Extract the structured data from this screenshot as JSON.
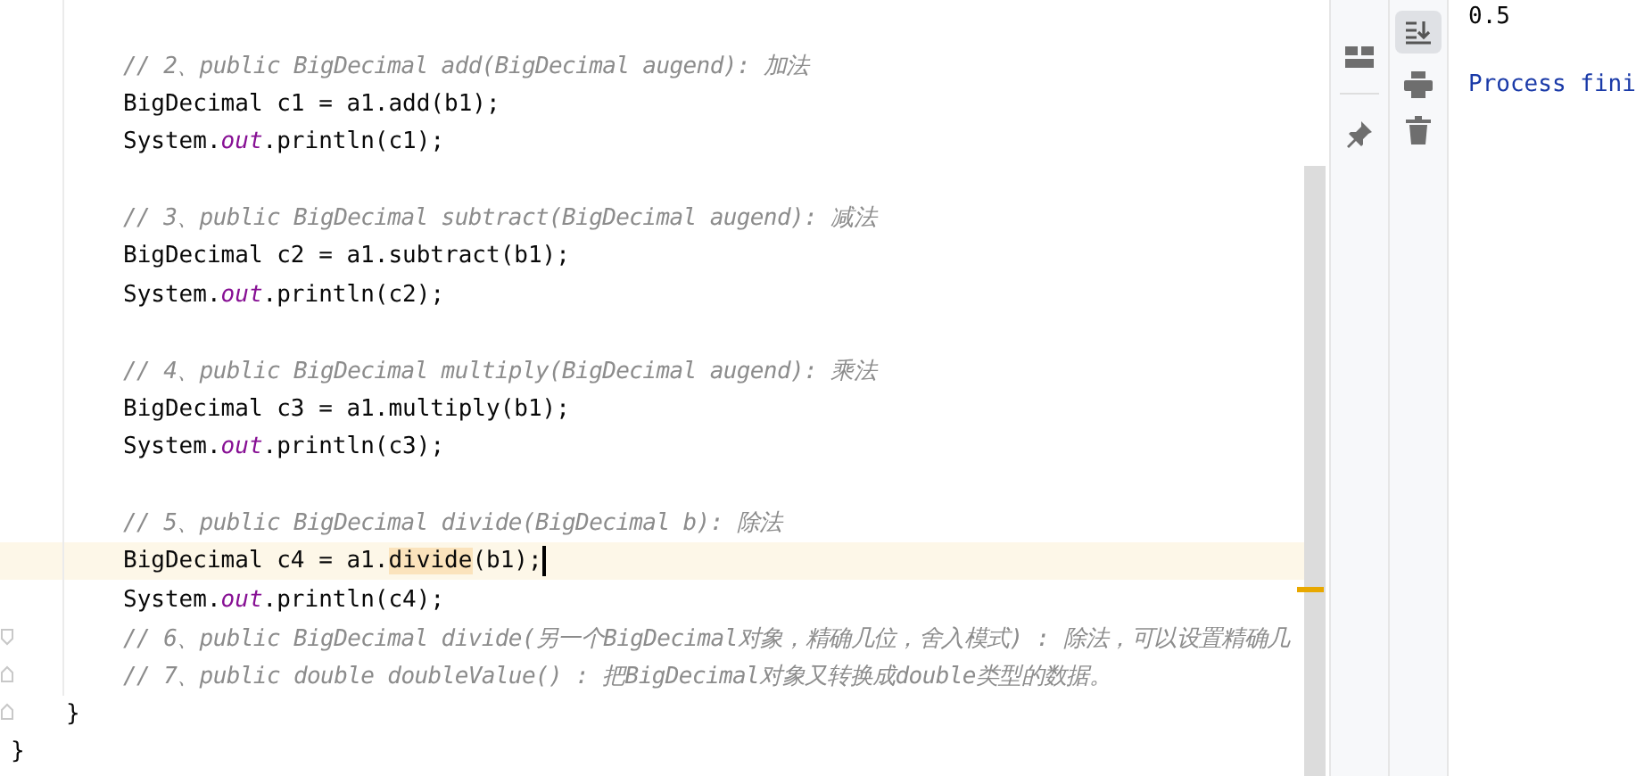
{
  "editor": {
    "lines": [
      {
        "kind": "comment",
        "selected": false,
        "tokens": [
          {
            "text": "// 2、public BigDecimal add(BigDecimal augend): 加法",
            "kind": "comment"
          }
        ]
      },
      {
        "kind": "code",
        "selected": false,
        "tokens": [
          {
            "text": "BigDecimal c1 = a1.add(b1);",
            "kind": "plain"
          }
        ]
      },
      {
        "kind": "code",
        "selected": false,
        "tokens": [
          {
            "text": "System.",
            "kind": "plain"
          },
          {
            "text": "out",
            "kind": "field"
          },
          {
            "text": ".println(c1);",
            "kind": "plain"
          }
        ]
      },
      {
        "kind": "blank",
        "selected": false
      },
      {
        "kind": "comment",
        "selected": false,
        "tokens": [
          {
            "text": "// 3、public BigDecimal subtract(BigDecimal augend): 减法",
            "kind": "comment"
          }
        ]
      },
      {
        "kind": "code",
        "selected": false,
        "tokens": [
          {
            "text": "BigDecimal c2 = a1.subtract(b1);",
            "kind": "plain"
          }
        ]
      },
      {
        "kind": "code",
        "selected": false,
        "tokens": [
          {
            "text": "System.",
            "kind": "plain"
          },
          {
            "text": "out",
            "kind": "field"
          },
          {
            "text": ".println(c2);",
            "kind": "plain"
          }
        ]
      },
      {
        "kind": "blank",
        "selected": false
      },
      {
        "kind": "comment",
        "selected": false,
        "tokens": [
          {
            "text": "// 4、public BigDecimal multiply(BigDecimal augend): 乘法",
            "kind": "comment"
          }
        ]
      },
      {
        "kind": "code",
        "selected": false,
        "tokens": [
          {
            "text": "BigDecimal c3 = a1.multiply(b1);",
            "kind": "plain"
          }
        ]
      },
      {
        "kind": "code",
        "selected": false,
        "tokens": [
          {
            "text": "System.",
            "kind": "plain"
          },
          {
            "text": "out",
            "kind": "field"
          },
          {
            "text": ".println(c3);",
            "kind": "plain"
          }
        ]
      },
      {
        "kind": "blank",
        "selected": false
      },
      {
        "kind": "comment",
        "selected": false,
        "tokens": [
          {
            "text": "// 5、public BigDecimal divide(BigDecimal b): 除法",
            "kind": "comment"
          }
        ]
      },
      {
        "kind": "code",
        "selected": true,
        "tokens": [
          {
            "text": "BigDecimal c4 = a1.",
            "kind": "plain"
          },
          {
            "text": "divide",
            "kind": "match"
          },
          {
            "text": "(b1);",
            "kind": "plain"
          }
        ]
      },
      {
        "kind": "code",
        "selected": false,
        "tokens": [
          {
            "text": "System.",
            "kind": "plain"
          },
          {
            "text": "out",
            "kind": "field"
          },
          {
            "text": ".println(c4);",
            "kind": "plain"
          }
        ]
      },
      {
        "kind": "comment",
        "selected": false,
        "tokens": [
          {
            "text": "// 6、public BigDecimal divide(另一个BigDecimal对象，精确几位，舍入模式) : 除法，可以设置精确几",
            "kind": "comment"
          }
        ]
      },
      {
        "kind": "comment",
        "selected": false,
        "tokens": [
          {
            "text": "// 7、public double doubleValue() : 把BigDecimal对象又转换成double类型的数据。",
            "kind": "comment"
          }
        ]
      },
      {
        "kind": "method_close",
        "selected": false,
        "tokens": [
          {
            "text": "}",
            "kind": "plain"
          }
        ]
      },
      {
        "kind": "class_close",
        "selected": false,
        "tokens": [
          {
            "text": "}",
            "kind": "plain"
          }
        ]
      }
    ]
  },
  "console": {
    "lines": [
      {
        "text": "0.5",
        "kind": "output"
      },
      {
        "text": "Process fini",
        "kind": "system"
      }
    ]
  }
}
